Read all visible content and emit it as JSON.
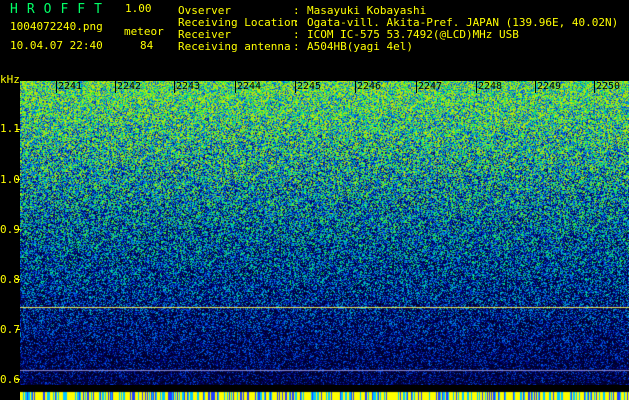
{
  "app": {
    "name": "HROFFT",
    "version": "1.00"
  },
  "file": {
    "name": "1004072240.png",
    "datetime": "10.04.07 22:40"
  },
  "event": {
    "label": "meteor",
    "count": "84"
  },
  "info": [
    {
      "key": "Ovserver",
      "value": "Masayuki Kobayashi"
    },
    {
      "key": "Receiving Location",
      "value": "Ogata-vill. Akita-Pref. JAPAN (139.96E, 40.02N)"
    },
    {
      "key": "Receiver",
      "value": "ICOM IC-575 53.7492(@LCD)MHz USB"
    },
    {
      "key": "Receiving antenna",
      "value": "A504HB(yagi 4el)"
    }
  ],
  "axis": {
    "y_unit": "kHz",
    "y_ticks": [
      "1.1",
      "1.0",
      "0.9",
      "0.8",
      "0.7",
      "0.6"
    ],
    "x_ticks": [
      "2241",
      "2242",
      "2243",
      "2244",
      "2245",
      "2246",
      "2247",
      "2248",
      "2249",
      "2250"
    ]
  },
  "colors": {
    "text": "#ffff00",
    "brand": "#00ff66",
    "marker": "#ffff00"
  }
}
